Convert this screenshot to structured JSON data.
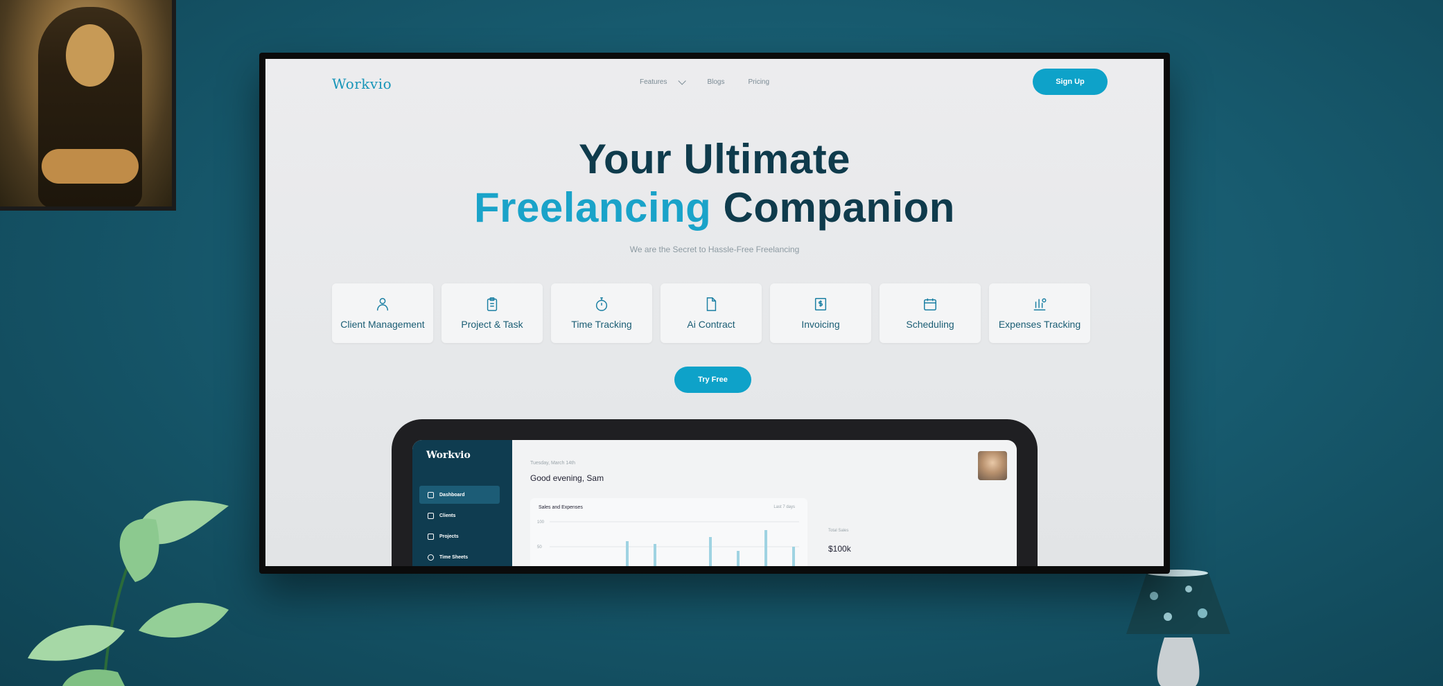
{
  "app": {
    "logo": "Workvio"
  },
  "nav": {
    "links": [
      {
        "label": "Features",
        "has_dropdown": true
      },
      {
        "label": "Blogs"
      },
      {
        "label": "Pricing"
      }
    ],
    "signup_label": "Sign Up"
  },
  "hero": {
    "title_line1": "Your Ultimate",
    "title_accent": "Freelancing",
    "title_rest": "Companion",
    "subtitle": "We are the Secret to Hassle-Free Freelancing",
    "cta_label": "Try Free"
  },
  "features": [
    {
      "label": "Client Management",
      "icon": "user-icon"
    },
    {
      "label": "Project & Task",
      "icon": "clipboard-icon"
    },
    {
      "label": "Time Tracking",
      "icon": "stopwatch-icon"
    },
    {
      "label": "Ai Contract",
      "icon": "document-icon"
    },
    {
      "label": "Invoicing",
      "icon": "invoice-icon"
    },
    {
      "label": "Scheduling",
      "icon": "calendar-icon"
    },
    {
      "label": "Expenses Tracking",
      "icon": "expenses-icon"
    }
  ],
  "dashboard": {
    "logo": "Workvio",
    "nav_items": [
      {
        "label": "Dashboard",
        "active": true
      },
      {
        "label": "Clients"
      },
      {
        "label": "Projects"
      },
      {
        "label": "Time Sheets"
      }
    ],
    "date": "Tuesday, March 14th",
    "greeting": "Good evening, Sam",
    "chart_title": "Sales and Expenses",
    "chart_filter": "Last 7 days",
    "chart_y_ticks": [
      "100",
      "50"
    ],
    "stat_label": "Total Sales",
    "stat_value": "$100k"
  },
  "colors": {
    "accent": "#0ea2c9",
    "heading": "#0f3b4c",
    "wall": "#175a6e",
    "sidebar": "#0f3c50"
  }
}
